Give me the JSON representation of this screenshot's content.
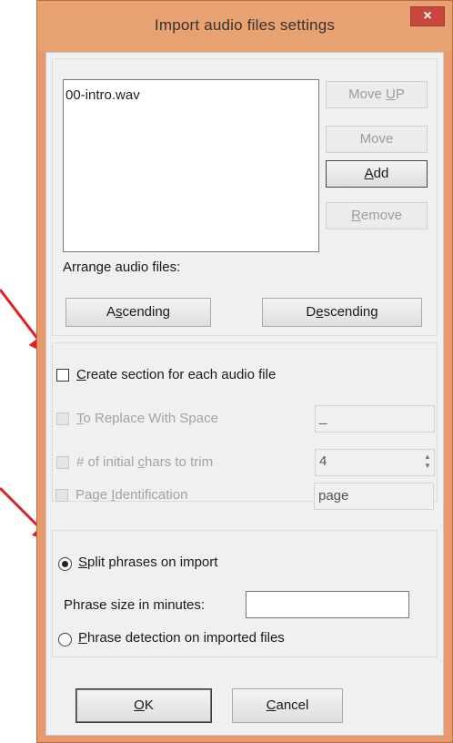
{
  "window": {
    "title": "Import audio files settings",
    "close_glyph": "×"
  },
  "file_list": {
    "items": [
      "00-intro.wav"
    ]
  },
  "buttons": {
    "move_up": {
      "pre": "Move ",
      "key": "U",
      "post": "P"
    },
    "move_down": {
      "pre": "Move",
      "key": "",
      "post": ""
    },
    "add": {
      "pre": "",
      "key": "A",
      "post": "dd"
    },
    "remove": {
      "pre": "",
      "key": "R",
      "post": "emove"
    },
    "ascending": {
      "pre": "A",
      "key": "s",
      "post": "cending"
    },
    "descending": {
      "pre": "D",
      "key": "e",
      "post": "scending"
    },
    "ok": {
      "pre": "",
      "key": "O",
      "post": "K"
    },
    "cancel": {
      "pre": "",
      "key": "C",
      "post": "ancel"
    }
  },
  "arrange_label": "Arrange audio files:",
  "section_options": {
    "create_section": {
      "pre": "",
      "key": "C",
      "post": "reate section for each audio file"
    },
    "replace_with_space": {
      "pre": "",
      "key": "T",
      "post": "o Replace With Space",
      "value": "_"
    },
    "trim_chars": {
      "pre": "# of initial ",
      "key": "c",
      "post": "hars to trim",
      "value": "4"
    },
    "page_identification": {
      "pre": "Page ",
      "key": "I",
      "post": "dentification",
      "value": "page"
    }
  },
  "phrase_options": {
    "split_phrases": {
      "pre": "",
      "key": "S",
      "post": "plit phrases on import"
    },
    "phrase_size_label": "Phrase size in minutes:",
    "phrase_size_value": "",
    "phrase_detection": {
      "pre": "",
      "key": "P",
      "post": "hrase detection on imported files"
    }
  },
  "colors": {
    "annotation_arrow": "#e21f1f",
    "title_bar": "#e8a171",
    "close_button": "#c8463c"
  },
  "icons": {
    "close": "close-icon",
    "spin": "spin-arrows-icon",
    "annotation": "red-arrow-icon"
  }
}
